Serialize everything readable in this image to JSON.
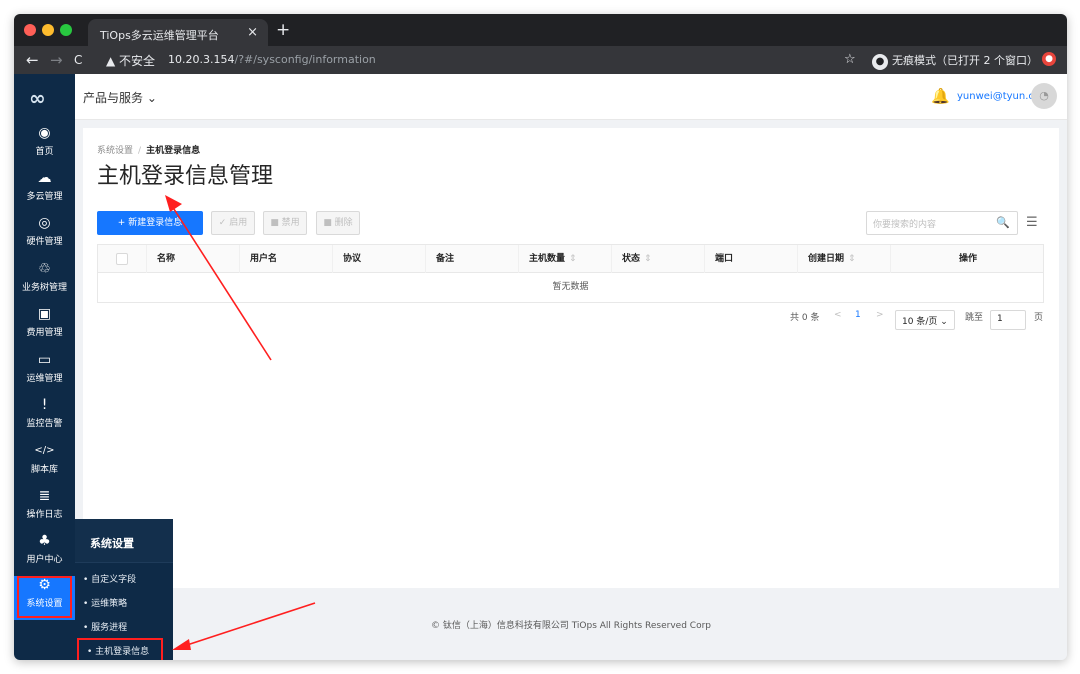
{
  "browser": {
    "tab_title": "TiOps多云运维管理平台",
    "tab_close": "×",
    "new_tab": "+",
    "back": "←",
    "forward": "→",
    "reload": "C",
    "security_label": "▲ 不安全",
    "url_host": "10.20.3.154",
    "url_path": "/?#/sysconfig/information",
    "star": "☆",
    "incognito_icon": "●",
    "incognito_label": "无痕模式（已打开 2 个窗口）",
    "extension_icon": "●"
  },
  "sidebar": {
    "logo": "∞",
    "items": [
      {
        "label": "首页",
        "icon": "dashboard-icon",
        "glyph": "◉"
      },
      {
        "label": "多云管理",
        "icon": "cloud-icon",
        "glyph": "☁"
      },
      {
        "label": "硬件管理",
        "icon": "hardware-icon",
        "glyph": "◎"
      },
      {
        "label": "业务树管理",
        "icon": "tree-icon",
        "glyph": "♲"
      },
      {
        "label": "费用管理",
        "icon": "cost-icon",
        "glyph": "▣"
      },
      {
        "label": "运维管理",
        "icon": "monitor-icon",
        "glyph": "▭"
      },
      {
        "label": "监控告警",
        "icon": "alert-icon",
        "glyph": "!"
      },
      {
        "label": "脚本库",
        "icon": "script-icon",
        "glyph": "</>"
      },
      {
        "label": "操作日志",
        "icon": "log-icon",
        "glyph": "≣"
      },
      {
        "label": "用户中心",
        "icon": "user-icon",
        "glyph": "♣"
      },
      {
        "label": "系统设置",
        "icon": "settings-icon",
        "glyph": "⚙"
      }
    ]
  },
  "topbar": {
    "products": "产品与服务 ⌄",
    "bell": "🔔",
    "user_email": "yunwei@tyun.cn",
    "avatar": "◔"
  },
  "breadcrumb": {
    "parent": "系统设置",
    "separator": "/",
    "current": "主机登录信息"
  },
  "page": {
    "title": "主机登录信息管理"
  },
  "toolbar": {
    "new_label": "+ 新建登录信息",
    "enable_label": "✓ 启用",
    "disable_label": "■ 禁用",
    "delete_label": "■ 删除",
    "search_placeholder": "你要搜索的内容",
    "search_icon": "🔍",
    "settings_icon": "☰"
  },
  "table": {
    "columns": [
      "名称",
      "用户名",
      "协议",
      "备注",
      "主机数量",
      "状态",
      "端口",
      "创建日期",
      "操作"
    ],
    "sort_glyph": "⇕",
    "empty_text": "暂无数据"
  },
  "pagination": {
    "total": "共 0 条",
    "prev": "<",
    "page": "1",
    "next": ">",
    "page_size": "10 条/页 ⌄",
    "jump_label": "跳至",
    "jump_value": "1",
    "page_suffix": "页"
  },
  "footer": {
    "text": "© 钛信（上海）信息科技有限公司 TiOps All Rights Reserved Corp"
  },
  "flyout": {
    "title": "系统设置",
    "items": [
      "自定义字段",
      "运维策略",
      "服务进程",
      "主机登录信息"
    ]
  },
  "colors": {
    "sidebar": "#0e2a47",
    "primary": "#1677ff",
    "annotation": "#ff1f1f"
  }
}
